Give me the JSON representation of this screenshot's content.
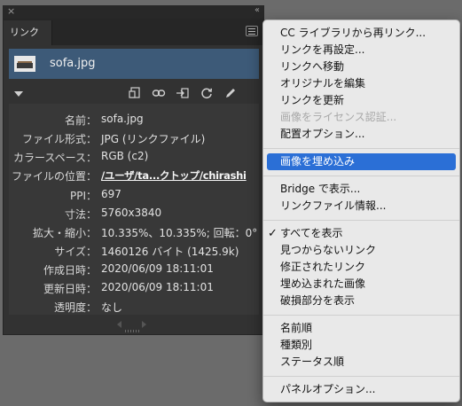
{
  "panel": {
    "close_glyph": "×",
    "collapse_glyph": "‹‹",
    "tab_label": "リンク",
    "link_name": "sofa.jpg",
    "details": [
      {
        "label": "名前：",
        "value": "sofa.jpg"
      },
      {
        "label": "ファイル形式：",
        "value": "JPG (リンクファイル)"
      },
      {
        "label": "カラースペース：",
        "value": "RGB (c2)"
      },
      {
        "label": "ファイルの位置：",
        "value": "/ユーザ/ta...クトップ/chirashi"
      },
      {
        "label": "PPI：",
        "value": "697"
      },
      {
        "label": "寸法：",
        "value": "5760x3840"
      },
      {
        "label": "拡大・縮小：",
        "value": "10.335%、10.335%; 回転：0°"
      },
      {
        "label": "サイズ：",
        "value": "1460126 バイト (1425.9k)"
      },
      {
        "label": "作成日時：",
        "value": "2020/06/09 18:11:01"
      },
      {
        "label": "更新日時：",
        "value": "2020/06/09 18:11:01"
      },
      {
        "label": "透明度：",
        "value": "なし"
      }
    ]
  },
  "menu": {
    "items": [
      "CC ライブラリから再リンク...",
      "リンクを再設定...",
      "リンクへ移動",
      "オリジナルを編集",
      "リンクを更新",
      "画像をライセンス認証...",
      "配置オプション...",
      "画像を埋め込み",
      "Bridge で表示...",
      "リンクファイル情報...",
      "すべてを表示",
      "見つからないリンク",
      "修正されたリンク",
      "埋め込まれた画像",
      "破損部分を表示",
      "名前順",
      "種類別",
      "ステータス順",
      "パネルオプション..."
    ],
    "check_glyph": "✓"
  },
  "colors": {
    "panel_bg": "#323232",
    "selected_row": "#3d5a78",
    "menu_highlight": "#2b6fd6"
  }
}
